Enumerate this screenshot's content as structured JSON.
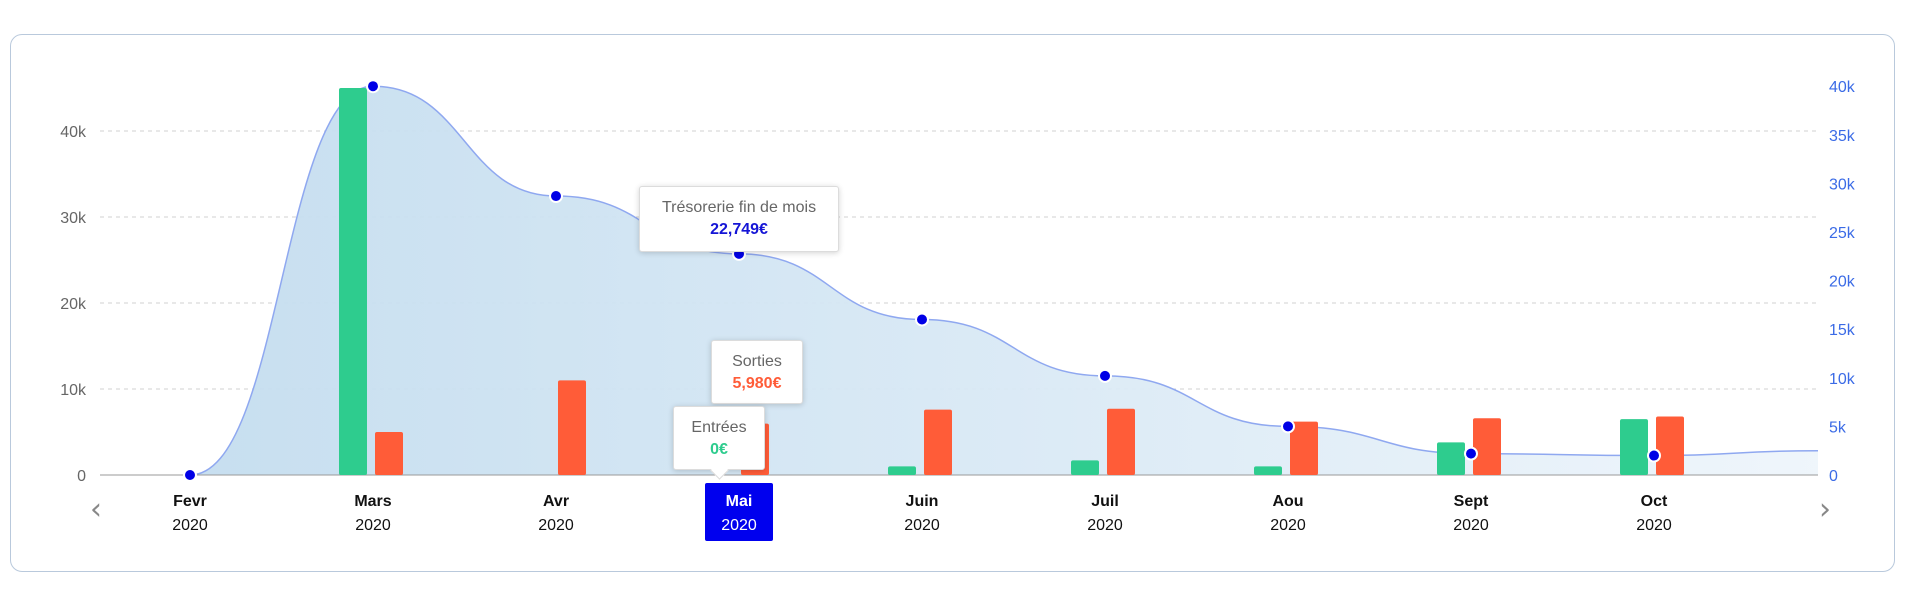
{
  "colors": {
    "entrees": "#2ecc8e",
    "sorties": "#ff5c38",
    "tresorerie_line": "#8fa8f0",
    "tresorerie_point": "#0000e6",
    "tresorerie_fill": "#cfe3f2",
    "selected_bg": "#0000ee",
    "grid": "#d0d0d0",
    "right_axis": "#3b6be6"
  },
  "icons": {
    "prev": "chevron-left-icon",
    "next": "chevron-right-icon"
  },
  "nav": {
    "prev_glyph": "‹",
    "next_glyph": "›"
  },
  "chart_data": {
    "type": "bar",
    "title": "",
    "categories": [
      {
        "month": "Fevr",
        "year": "2020"
      },
      {
        "month": "Mars",
        "year": "2020"
      },
      {
        "month": "Avr",
        "year": "2020"
      },
      {
        "month": "Mai",
        "year": "2020"
      },
      {
        "month": "Juin",
        "year": "2020"
      },
      {
        "month": "Juil",
        "year": "2020"
      },
      {
        "month": "Aou",
        "year": "2020"
      },
      {
        "month": "Sept",
        "year": "2020"
      },
      {
        "month": "Oct",
        "year": "2020"
      }
    ],
    "selected_index": 3,
    "series": [
      {
        "name": "Entrées",
        "type": "bar",
        "axis": "left",
        "values": [
          0,
          45000,
          0,
          0,
          1000,
          1700,
          1000,
          3800,
          6500
        ]
      },
      {
        "name": "Sorties",
        "type": "bar",
        "axis": "left",
        "values": [
          0,
          5000,
          11000,
          5980,
          7600,
          7700,
          6200,
          6600,
          6800
        ]
      },
      {
        "name": "Trésorerie fin de mois",
        "type": "area",
        "axis": "right",
        "values": [
          0,
          40000,
          28700,
          22749,
          16000,
          10200,
          5000,
          2200,
          2000
        ],
        "end_value": 2500
      }
    ],
    "left_axis": {
      "ylim": [
        0,
        45000
      ],
      "ticks": [
        0,
        10000,
        20000,
        30000,
        40000
      ],
      "tick_labels": [
        "0",
        "10k",
        "20k",
        "30k",
        "40k"
      ]
    },
    "right_axis": {
      "ylim": [
        0,
        40000
      ],
      "ticks": [
        0,
        5000,
        10000,
        15000,
        20000,
        25000,
        30000,
        35000,
        40000
      ],
      "tick_labels": [
        "0",
        "5k",
        "10k",
        "15k",
        "20k",
        "25k",
        "30k",
        "35k",
        "40k"
      ]
    },
    "grid": true,
    "tooltips": {
      "tresorerie": {
        "title": "Trésorerie fin de mois",
        "value": "22,749€"
      },
      "sorties": {
        "title": "Sorties",
        "value": "5,980€"
      },
      "entrees": {
        "title": "Entrées",
        "value": "0€"
      }
    }
  }
}
